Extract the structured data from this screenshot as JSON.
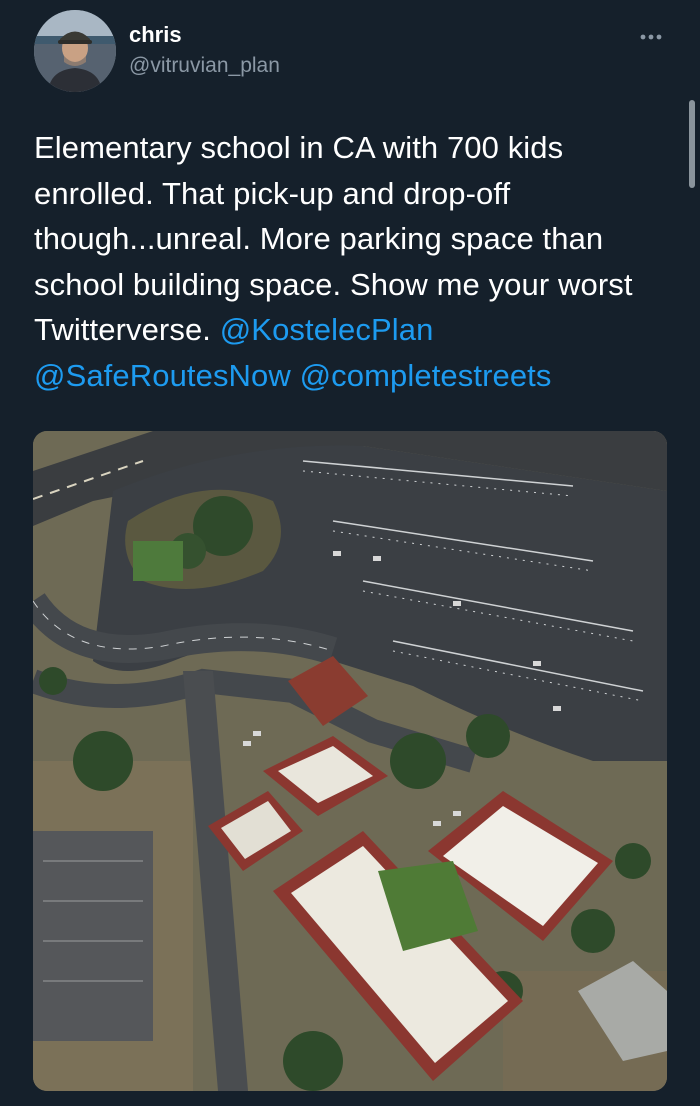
{
  "tweet": {
    "author": {
      "display_name": "chris",
      "handle": "@vitruvian_plan"
    },
    "more_icon": "more-horizontal-icon",
    "text_plain": "Elementary school in CA with 700 kids enrolled. That pick-up and drop-off though...unreal. More parking space than school building space. Show me your worst Twitterverse.",
    "mentions": [
      "@KostelecPlan",
      "@SafeRoutesNow",
      "@completestreets"
    ],
    "colors": {
      "background": "#15202b",
      "text": "#ffffff",
      "secondary_text": "#8b98a5",
      "link": "#1d9bf0"
    }
  }
}
